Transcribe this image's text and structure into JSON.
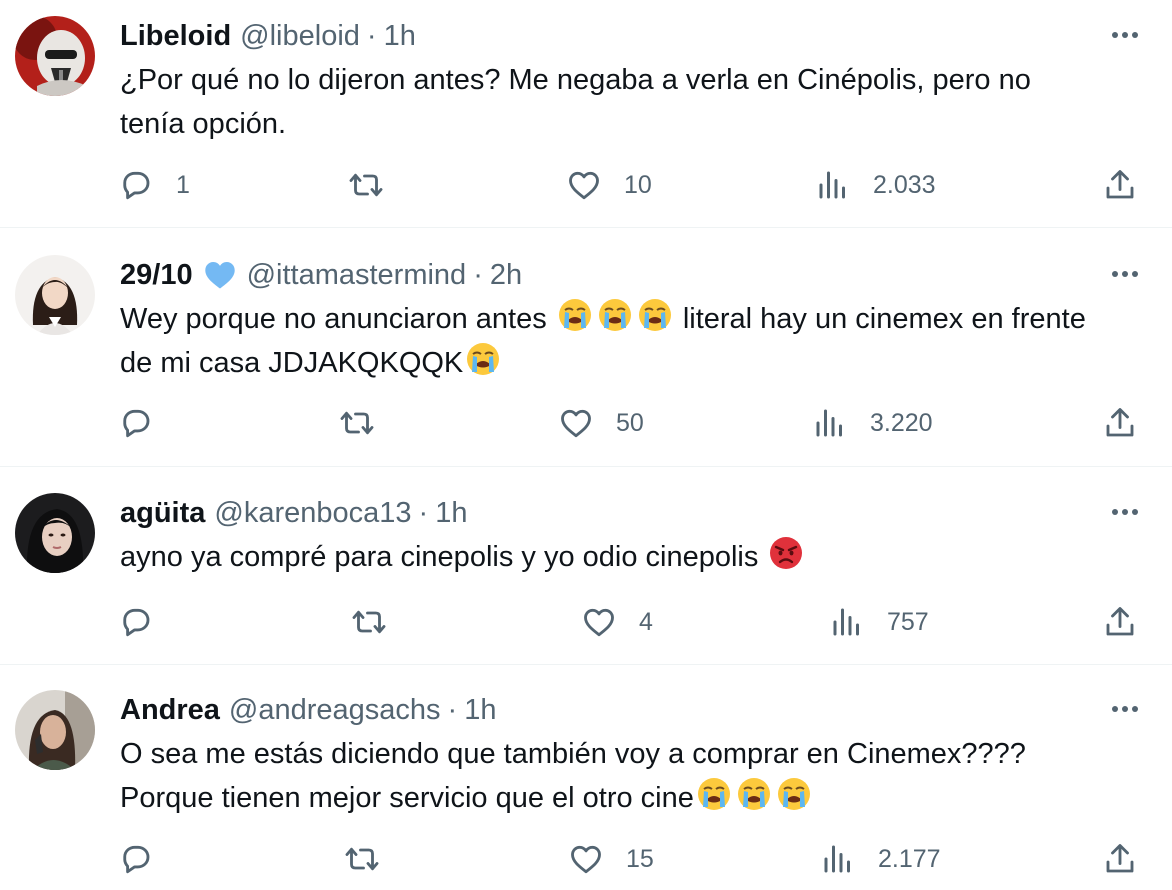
{
  "tweets": [
    {
      "name": "Libeloid",
      "handle": "@libeloid",
      "separator": "·",
      "time": "1h",
      "verified": false,
      "text_lines": [
        "¿Por qué no lo dijeron antes? Me negaba a verla en Cinépolis, pero no",
        "tenía opción."
      ],
      "replies": "1",
      "retweets": "",
      "likes": "10",
      "views": "2.033"
    },
    {
      "name": "29/10",
      "handle": "@ittamastermind",
      "separator": "·",
      "time": "2h",
      "verified": true,
      "text_line1_a": "Wey porque no anunciaron antes ",
      "text_line1_b": " literal hay un cinemex en frente",
      "text_line2_a": "de mi casa JDJAKQKQQK",
      "emoji_1": "loudly-crying-face",
      "emoji_2": "loudly-crying-face",
      "replies": "",
      "retweets": "",
      "likes": "50",
      "views": "3.220"
    },
    {
      "name": "agüita",
      "handle": "@karenboca13",
      "separator": "·",
      "time": "1h",
      "verified": false,
      "text_line1_a": "ayno ya compré para cinepolis y yo odio cinepolis ",
      "emoji_1": "angry-face",
      "replies": "",
      "retweets": "",
      "likes": "4",
      "views": "757"
    },
    {
      "name": "Andrea",
      "handle": "@andreagsachs",
      "separator": "·",
      "time": "1h",
      "verified": false,
      "text_line1": "O sea me estás diciendo que también voy a comprar en Cinemex????",
      "text_line2_a": "Porque tienen mejor servicio que el otro cine",
      "emoji_1": "loudly-crying-face",
      "replies": "",
      "retweets": "",
      "likes": "15",
      "views": "2.177"
    }
  ],
  "colors": {
    "text": "#0f1419",
    "secondary": "#536471",
    "divider": "#eff3f4",
    "verified_heart": "#74b9f3"
  }
}
